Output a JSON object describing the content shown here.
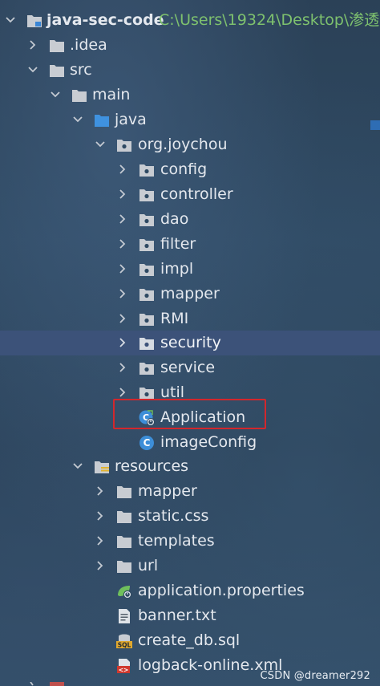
{
  "project": {
    "name": "java-sec-code",
    "path": "C:\\Users\\19324\\Desktop\\渗透"
  },
  "nodes": [
    {
      "label": ".idea",
      "icon": "folder-icon",
      "expand": "collapsed"
    },
    {
      "label": "src",
      "icon": "folder-icon",
      "expand": "expanded"
    },
    {
      "label": "main",
      "icon": "folder-icon",
      "expand": "expanded"
    },
    {
      "label": "java",
      "icon": "source-folder-icon",
      "expand": "expanded"
    },
    {
      "label": "org.joychou",
      "icon": "package-icon",
      "expand": "expanded"
    },
    {
      "label": "config",
      "icon": "package-icon",
      "expand": "collapsed"
    },
    {
      "label": "controller",
      "icon": "package-icon",
      "expand": "collapsed"
    },
    {
      "label": "dao",
      "icon": "package-icon",
      "expand": "collapsed"
    },
    {
      "label": "filter",
      "icon": "package-icon",
      "expand": "collapsed"
    },
    {
      "label": "impl",
      "icon": "package-icon",
      "expand": "collapsed"
    },
    {
      "label": "mapper",
      "icon": "package-icon",
      "expand": "collapsed"
    },
    {
      "label": "RMI",
      "icon": "package-icon",
      "expand": "collapsed"
    },
    {
      "label": "security",
      "icon": "package-icon",
      "expand": "collapsed",
      "selected": true
    },
    {
      "label": "service",
      "icon": "package-icon",
      "expand": "collapsed"
    },
    {
      "label": "util",
      "icon": "package-icon",
      "expand": "collapsed"
    },
    {
      "label": "Application",
      "icon": "spring-boot-class-icon",
      "expand": "none",
      "highlighted": true
    },
    {
      "label": "imageConfig",
      "icon": "class-icon",
      "expand": "none"
    },
    {
      "label": "resources",
      "icon": "resources-folder-icon",
      "expand": "expanded"
    },
    {
      "label": "mapper",
      "icon": "folder-icon",
      "expand": "collapsed"
    },
    {
      "label": "static.css",
      "icon": "folder-icon",
      "expand": "collapsed"
    },
    {
      "label": "templates",
      "icon": "folder-icon",
      "expand": "collapsed"
    },
    {
      "label": "url",
      "icon": "folder-icon",
      "expand": "collapsed"
    },
    {
      "label": "application.properties",
      "icon": "spring-properties-icon",
      "expand": "none"
    },
    {
      "label": "banner.txt",
      "icon": "text-file-icon",
      "expand": "none"
    },
    {
      "label": "create_db.sql",
      "icon": "sql-file-icon",
      "expand": "none"
    },
    {
      "label": "logback-online.xml",
      "icon": "xml-file-icon",
      "expand": "none"
    }
  ],
  "colors": {
    "text": "#e4e8ee",
    "path": "#7ec16e",
    "selection": "#3c5279",
    "highlight_border": "#d2272c"
  },
  "watermark": "CSDN @dreamer292"
}
